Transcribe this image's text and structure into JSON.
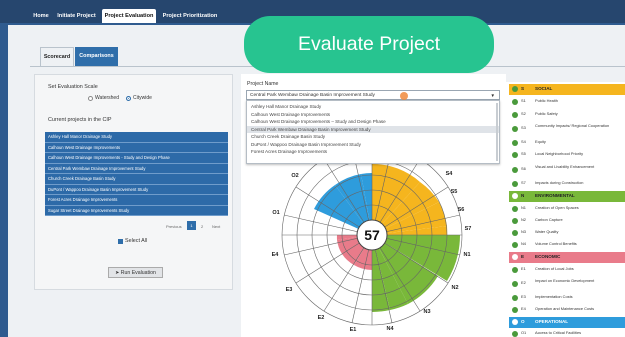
{
  "top_tabs": [
    {
      "label": "Home"
    },
    {
      "label": "Initiate Project"
    },
    {
      "label": "Project Evaluation"
    },
    {
      "label": "Project Prioritization"
    }
  ],
  "sub_tabs": [
    {
      "label": "Scorecard"
    },
    {
      "label": "Comparisons"
    }
  ],
  "banner": {
    "text": "Evaluate Project"
  },
  "left_panel": {
    "scale_label": "Set Evaluation Scale",
    "scale_options": [
      "Watershed",
      "Citywide"
    ],
    "scale_selected": "Citywide",
    "projects_heading": "Current projects in the CIP",
    "projects": [
      "Ashley Hall Manor Drainage Study",
      "Calhoun West Drainage Improvements",
      "Calhoun West Drainage Improvements - Study and Design Phase",
      "Central Park Wembaw Drainage Improvement Study",
      "Church Creek Drainage Basin Study",
      "DuPont / Wappoo Drainage Basin Improvement Study",
      "Forest Acres Drainage Improvements",
      "Sugar Street Drainage Improvements Study"
    ],
    "pager": {
      "previous": "Previous",
      "page1": "1",
      "page2": "2",
      "next": "Next"
    },
    "select_all": "Select All",
    "run_button": "Run Evaluation",
    "run_icon": "paper-plane-icon"
  },
  "center_panel": {
    "project_name_label": "Project Name",
    "selected_project": "Central Park Wembaw Drainage Basin Improvement Study",
    "dropdown_items": [
      "Ashley Hall Manor Drainage Study",
      "Calhoun West Drainage Improvements",
      "Calhoun West Drainage Improvements – Study and Design Phase",
      "Central Park Wembaw Drainage Basin Improvement Study",
      "Church Creek Drainage Basin Study",
      "DuPont / Wappoo Drainage Basin Improvement Study",
      "Forest Acres Drainage Improvements"
    ],
    "dropdown_selected_index": 3,
    "score": "57",
    "wedge_labels": [
      "O2",
      "O1",
      "E4",
      "E3",
      "E2",
      "E1",
      "N4",
      "N3",
      "N2",
      "N1",
      "S7",
      "S6",
      "S5",
      "S4"
    ],
    "colors": {
      "social": "#f5b51e",
      "environmental": "#79b83a",
      "economic": "#e97b8a",
      "operational": "#2e9cdc"
    }
  },
  "right_panel": {
    "categories": [
      {
        "code": "S",
        "name": "SOCIAL",
        "color": "#f5b51e",
        "items": [
          {
            "code": "S1",
            "name": "Public Health"
          },
          {
            "code": "S2",
            "name": "Public Safety"
          },
          {
            "code": "S3",
            "name": "Community Impacts/ Regional Cooperation"
          },
          {
            "code": "S4",
            "name": "Equity"
          },
          {
            "code": "S5",
            "name": "Local Neighborhood Priority"
          },
          {
            "code": "S6",
            "name": "Visual and Livability Enhancement"
          },
          {
            "code": "S7",
            "name": "Impacts during Construction"
          }
        ]
      },
      {
        "code": "N",
        "name": "ENVIRONMENTAL",
        "color": "#79b83a",
        "items": [
          {
            "code": "N1",
            "name": "Creation of Open Spaces"
          },
          {
            "code": "N2",
            "name": "Carbon Capture"
          },
          {
            "code": "N3",
            "name": "Water Quality"
          },
          {
            "code": "N4",
            "name": "Volume Control Benefits"
          }
        ]
      },
      {
        "code": "E",
        "name": "ECONOMIC",
        "color": "#e97b8a",
        "items": [
          {
            "code": "E1",
            "name": "Creation of Local Jobs"
          },
          {
            "code": "E2",
            "name": "Impact on Economic Development"
          },
          {
            "code": "E3",
            "name": "Implementation Costs"
          },
          {
            "code": "E4",
            "name": "Operation and Maintenance Costs"
          }
        ]
      },
      {
        "code": "O",
        "name": "OPERATIONAL",
        "color": "#2e9cdc",
        "items": [
          {
            "code": "O1",
            "name": "Access to Critical Facilities"
          }
        ]
      }
    ]
  }
}
